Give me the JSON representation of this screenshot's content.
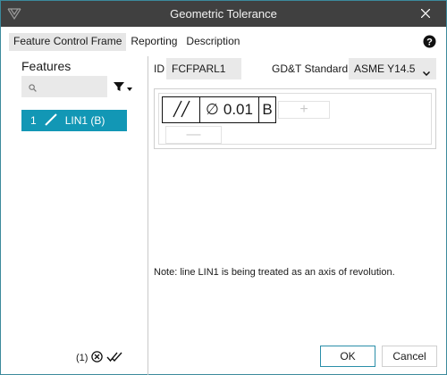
{
  "window": {
    "title": "Geometric Tolerance"
  },
  "tabs": [
    {
      "label": "Feature Control Frame",
      "active": true
    },
    {
      "label": "Reporting",
      "active": false
    },
    {
      "label": "Description",
      "active": false
    }
  ],
  "features_panel": {
    "title": "Features",
    "search_value": "",
    "items": [
      {
        "index": "1",
        "name": "LIN1 (B)",
        "icon": "line-icon",
        "selected": true
      }
    ]
  },
  "status": {
    "count": "(1)"
  },
  "id_field": {
    "label": "ID",
    "value": "FCFPARL1"
  },
  "standard": {
    "label": "GD&T Standard",
    "value": "ASME Y14.5"
  },
  "fcf": {
    "symbol": "parallelism",
    "diameter_symbol": "∅",
    "tolerance": "0.01",
    "datum": "B",
    "add_label": "+",
    "remove_label": "—"
  },
  "note": "Note: line LIN1 is being treated as an axis of revolution.",
  "buttons": {
    "ok": "OK",
    "cancel": "Cancel"
  },
  "colors": {
    "titlebar": "#404040",
    "accent": "#1297b5",
    "border": "#3c8a9c"
  }
}
